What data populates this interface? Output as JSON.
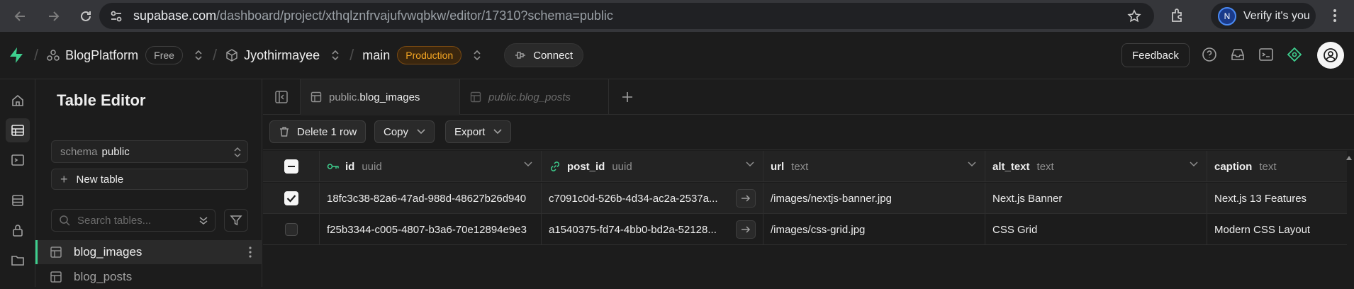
{
  "browser": {
    "url_host": "supabase.com",
    "url_path": "/dashboard/project/xthqlznfrvajufvwqbkw/editor/17310?schema=public",
    "profile_initial": "N",
    "profile_label": "Verify it's you"
  },
  "topbar": {
    "org_name": "BlogPlatform",
    "plan_badge": "Free",
    "project_name": "Jyothirmayee",
    "branch_name": "main",
    "env_badge": "Production",
    "connect_label": "Connect",
    "feedback_label": "Feedback",
    "accent_color": "#3ecf8e",
    "production_color": "#f5a623"
  },
  "sidebar": {
    "title": "Table Editor",
    "schema_label": "schema",
    "schema_value": "public",
    "new_table_label": "New table",
    "search_placeholder": "Search tables...",
    "tables": [
      {
        "name": "blog_images",
        "active": true
      },
      {
        "name": "blog_posts",
        "active": false
      }
    ]
  },
  "tabs": [
    {
      "schema": "public.",
      "name": "blog_images",
      "active": true
    },
    {
      "schema": "public.",
      "name": "blog_posts",
      "active": false
    }
  ],
  "toolbar": {
    "delete_label": "Delete 1 row",
    "copy_label": "Copy",
    "export_label": "Export"
  },
  "grid": {
    "columns": [
      {
        "name": "id",
        "type": "uuid",
        "icon": "key-icon"
      },
      {
        "name": "post_id",
        "type": "uuid",
        "icon": "link-icon"
      },
      {
        "name": "url",
        "type": "text"
      },
      {
        "name": "alt_text",
        "type": "text"
      },
      {
        "name": "caption",
        "type": "text"
      }
    ],
    "rows": [
      {
        "selected": true,
        "id": "18fc3c38-82a6-47ad-988d-48627b26d940",
        "post_id": "c7091c0d-526b-4d34-ac2a-2537a...",
        "url": "/images/nextjs-banner.jpg",
        "alt_text": "Next.js Banner",
        "caption": "Next.js 13 Features"
      },
      {
        "selected": false,
        "id": "f25b3344-c005-4807-b3a6-70e12894e9e3",
        "post_id": "a1540375-fd74-4bb0-bd2a-52128...",
        "url": "/images/css-grid.jpg",
        "alt_text": "CSS Grid",
        "caption": "Modern CSS Layout"
      }
    ]
  }
}
